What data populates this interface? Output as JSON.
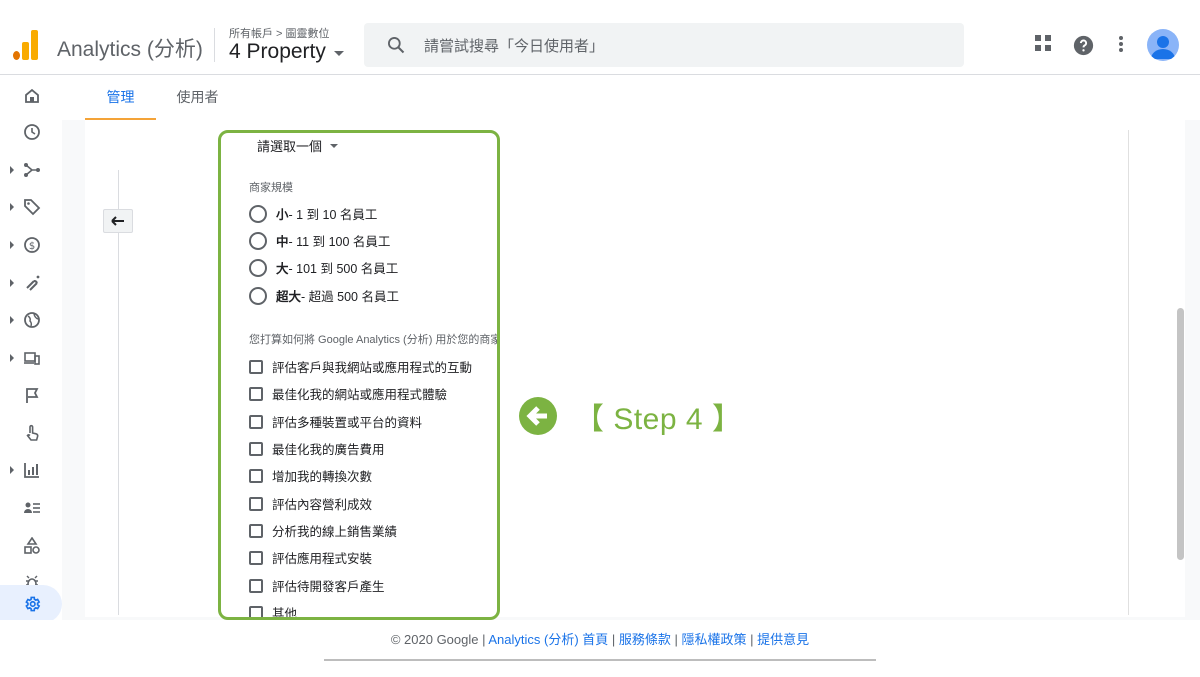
{
  "header": {
    "app_title": "Analytics (分析)",
    "breadcrumb": "所有帳戶 > 圖靈數位",
    "property": "4 Property",
    "search_placeholder": "請嘗試搜尋「今日使用者」"
  },
  "icons": {
    "apps": "apps-grid-icon",
    "help": "help-circle-icon",
    "more": "more-vert-icon",
    "account": "account-avatar-icon"
  },
  "tabs": [
    "管理",
    "使用者"
  ],
  "form": {
    "select_label": "請選取一個",
    "size_title": "商家規模",
    "size_options": [
      {
        "strong": "小",
        "rest": " - 1 到 10 名員工"
      },
      {
        "strong": "中",
        "rest": " - 11 到 100 名員工"
      },
      {
        "strong": "大",
        "rest": " - 101 到 500 名員工"
      },
      {
        "strong": "超大",
        "rest": " - 超過 500 名員工"
      }
    ],
    "usage_title": "您打算如何將 Google Analytics (分析) 用於您的商家？(可複選)",
    "usage_options": [
      "評估客戶與我網站或應用程式的互動",
      "最佳化我的網站或應用程式體驗",
      "評估多種裝置或平台的資料",
      "最佳化我的廣告費用",
      "增加我的轉換次數",
      "評估內容營利成效",
      "分析我的線上銷售業績",
      "評估應用程式安裝",
      "評估待開發客戶產生",
      "其他"
    ]
  },
  "annotation": {
    "step_text": "【 Step 4 】"
  },
  "footer": {
    "copyright": "© 2020 Google | ",
    "links": [
      "Analytics (分析) 首頁",
      "服務條款",
      "隱私權政策",
      "提供意見"
    ],
    "separator": " | "
  },
  "colors": {
    "accent_blue": "#1a73e8",
    "tab_underline": "#f4a338",
    "highlight_green": "#7cb342",
    "logo_orange": "#f9ab00",
    "logo_dark_orange": "#e37400"
  }
}
